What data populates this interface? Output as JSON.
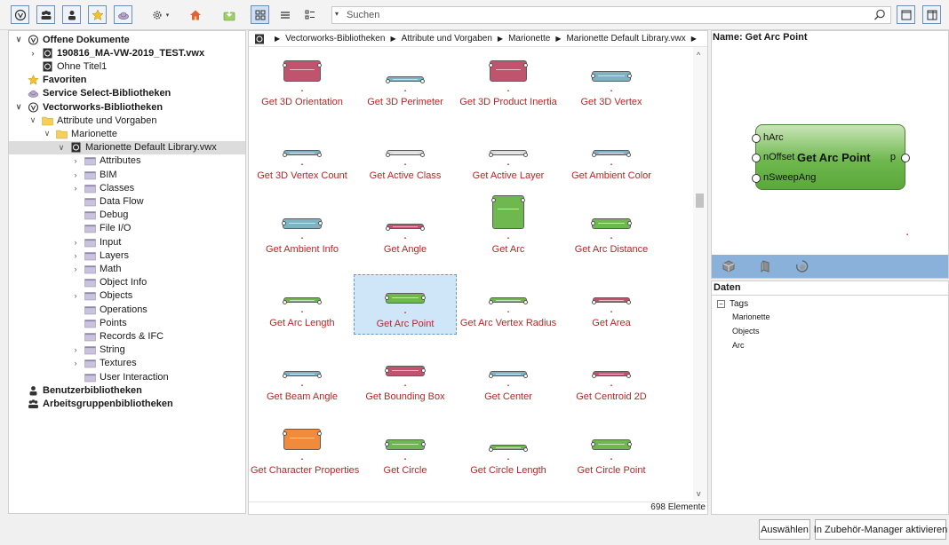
{
  "toolbar": {
    "buttons": [
      "vectorworks-circle-icon",
      "workgroup-icon",
      "user-icon",
      "favorites-star-icon",
      "cloud-icon",
      "gear-icon",
      "home-icon",
      "import-icon"
    ],
    "view_buttons": [
      "thumbnail-view-icon",
      "list-view-icon",
      "detail-view-icon"
    ],
    "search": {
      "placeholder": "Suchen"
    }
  },
  "tree": [
    {
      "label": "Offene Dokumente",
      "level": 0,
      "chev": "v",
      "icon": "vectorworks-circle-icon",
      "bold": true
    },
    {
      "label": "190816_MA-VW-2019_TEST.vwx",
      "level": 1,
      "chev": ">",
      "icon": "vwx-doc-icon",
      "bold": true
    },
    {
      "label": "Ohne Titel1",
      "level": 1,
      "chev": "",
      "icon": "vwx-doc-icon",
      "bold": false
    },
    {
      "label": "Favoriten",
      "level": 0,
      "chev": "",
      "icon": "favorites-star-icon",
      "bold": true
    },
    {
      "label": "Service Select-Bibliotheken",
      "level": 0,
      "chev": "",
      "icon": "cloud-icon",
      "bold": true
    },
    {
      "label": "Vectorworks-Bibliotheken",
      "level": 0,
      "chev": "v",
      "icon": "vectorworks-circle-icon",
      "bold": true
    },
    {
      "label": "Attribute und Vorgaben",
      "level": 1,
      "chev": "v",
      "icon": "folder-yellow-icon",
      "bold": false
    },
    {
      "label": "Marionette",
      "level": 2,
      "chev": "v",
      "icon": "folder-yellow-icon",
      "bold": false
    },
    {
      "label": "Marionette Default Library.vwx",
      "level": 3,
      "chev": "v",
      "icon": "vwx-doc-icon",
      "bold": false,
      "selected": true
    },
    {
      "label": "Attributes",
      "level": 4,
      "chev": ">",
      "icon": "folder-lilac-icon",
      "bold": false
    },
    {
      "label": "BIM",
      "level": 4,
      "chev": ">",
      "icon": "folder-lilac-icon",
      "bold": false
    },
    {
      "label": "Classes",
      "level": 4,
      "chev": ">",
      "icon": "folder-lilac-icon",
      "bold": false
    },
    {
      "label": "Data Flow",
      "level": 4,
      "chev": "",
      "icon": "folder-lilac-icon",
      "bold": false
    },
    {
      "label": "Debug",
      "level": 4,
      "chev": "",
      "icon": "folder-lilac-icon",
      "bold": false
    },
    {
      "label": "File I/O",
      "level": 4,
      "chev": "",
      "icon": "folder-lilac-icon",
      "bold": false
    },
    {
      "label": "Input",
      "level": 4,
      "chev": ">",
      "icon": "folder-lilac-icon",
      "bold": false
    },
    {
      "label": "Layers",
      "level": 4,
      "chev": ">",
      "icon": "folder-lilac-icon",
      "bold": false
    },
    {
      "label": "Math",
      "level": 4,
      "chev": ">",
      "icon": "folder-lilac-icon",
      "bold": false
    },
    {
      "label": "Object Info",
      "level": 4,
      "chev": "",
      "icon": "folder-lilac-icon",
      "bold": false
    },
    {
      "label": "Objects",
      "level": 4,
      "chev": ">",
      "icon": "folder-lilac-icon",
      "bold": false
    },
    {
      "label": "Operations",
      "level": 4,
      "chev": "",
      "icon": "folder-lilac-icon",
      "bold": false
    },
    {
      "label": "Points",
      "level": 4,
      "chev": "",
      "icon": "folder-lilac-icon",
      "bold": false
    },
    {
      "label": "Records & IFC",
      "level": 4,
      "chev": "",
      "icon": "folder-lilac-icon",
      "bold": false
    },
    {
      "label": "String",
      "level": 4,
      "chev": ">",
      "icon": "folder-lilac-icon",
      "bold": false
    },
    {
      "label": "Textures",
      "level": 4,
      "chev": ">",
      "icon": "folder-lilac-icon",
      "bold": false
    },
    {
      "label": "User Interaction",
      "level": 4,
      "chev": "",
      "icon": "folder-lilac-icon",
      "bold": false
    },
    {
      "label": "Benutzerbibliotheken",
      "level": 0,
      "chev": "",
      "icon": "user-icon",
      "bold": true
    },
    {
      "label": "Arbeitsgruppenbibliotheken",
      "level": 0,
      "chev": "",
      "icon": "workgroup-icon",
      "bold": true
    }
  ],
  "breadcrumb": [
    "Vectorworks-Bibliotheken",
    "Attribute und Vorgaben",
    "Marionette",
    "Marionette Default Library.vwx"
  ],
  "items": [
    {
      "label": "Get 3D Orientation",
      "color": "#c0546f",
      "size": "big"
    },
    {
      "label": "Get 3D Perimeter",
      "color": "#7fb3c4",
      "size": "thin"
    },
    {
      "label": "Get 3D Product Inertia",
      "color": "#c0546f",
      "size": "big"
    },
    {
      "label": "Get 3D Vertex",
      "color": "#7fb3c4",
      "size": "mid"
    },
    {
      "label": "Get 3D Vertex Count",
      "color": "#7fb3c4",
      "size": "thin"
    },
    {
      "label": "Get Active Class",
      "color": "#dcdcdc",
      "size": "thin"
    },
    {
      "label": "Get Active Layer",
      "color": "#dcdcdc",
      "size": "thin"
    },
    {
      "label": "Get Ambient Color",
      "color": "#7fb3c4",
      "size": "thin"
    },
    {
      "label": "Get Ambient Info",
      "color": "#7fb3c4",
      "size": "mid"
    },
    {
      "label": "Get Angle",
      "color": "#c0546f",
      "size": "thin"
    },
    {
      "label": "Get Arc",
      "color": "#6fb84f",
      "size": "huge"
    },
    {
      "label": "Get Arc Distance",
      "color": "#6fb84f",
      "size": "mid"
    },
    {
      "label": "Get Arc Length",
      "color": "#6fb84f",
      "size": "thin"
    },
    {
      "label": "Get Arc Point",
      "color": "#6fb84f",
      "size": "mid",
      "selected": true
    },
    {
      "label": "Get Arc Vertex Radius",
      "color": "#6fb84f",
      "size": "thin"
    },
    {
      "label": "Get Area",
      "color": "#c0546f",
      "size": "thin"
    },
    {
      "label": "Get Beam Angle",
      "color": "#7fb3c4",
      "size": "thin"
    },
    {
      "label": "Get Bounding Box",
      "color": "#c0546f",
      "size": "mid"
    },
    {
      "label": "Get Center",
      "color": "#7fb3c4",
      "size": "thin"
    },
    {
      "label": "Get Centroid 2D",
      "color": "#c0546f",
      "size": "thin"
    },
    {
      "label": "Get Character Properties",
      "color": "#f28a3c",
      "size": "big"
    },
    {
      "label": "Get Circle",
      "color": "#6fb84f",
      "size": "mid"
    },
    {
      "label": "Get Circle Length",
      "color": "#6fb84f",
      "size": "thin"
    },
    {
      "label": "Get Circle Point",
      "color": "#6fb84f",
      "size": "mid"
    },
    {
      "label": "",
      "color": "#ffffff",
      "size": "mid"
    }
  ],
  "count": "698 Elemente",
  "preview": {
    "title": "Name: Get Arc Point",
    "node_title": "Get Arc Point",
    "inputs": [
      "hArc",
      "nOffset",
      "nSweepAng"
    ],
    "output": "p",
    "toolbar": [
      "top-view-icon",
      "front-view-icon",
      "rotate-view-icon"
    ]
  },
  "data": {
    "header": "Daten",
    "tags_label": "Tags",
    "tags": [
      "Marionette",
      "Objects",
      "Arc"
    ]
  },
  "buttons": {
    "select": "Auswählen",
    "activate": "In Zubehör-Manager aktivieren"
  }
}
